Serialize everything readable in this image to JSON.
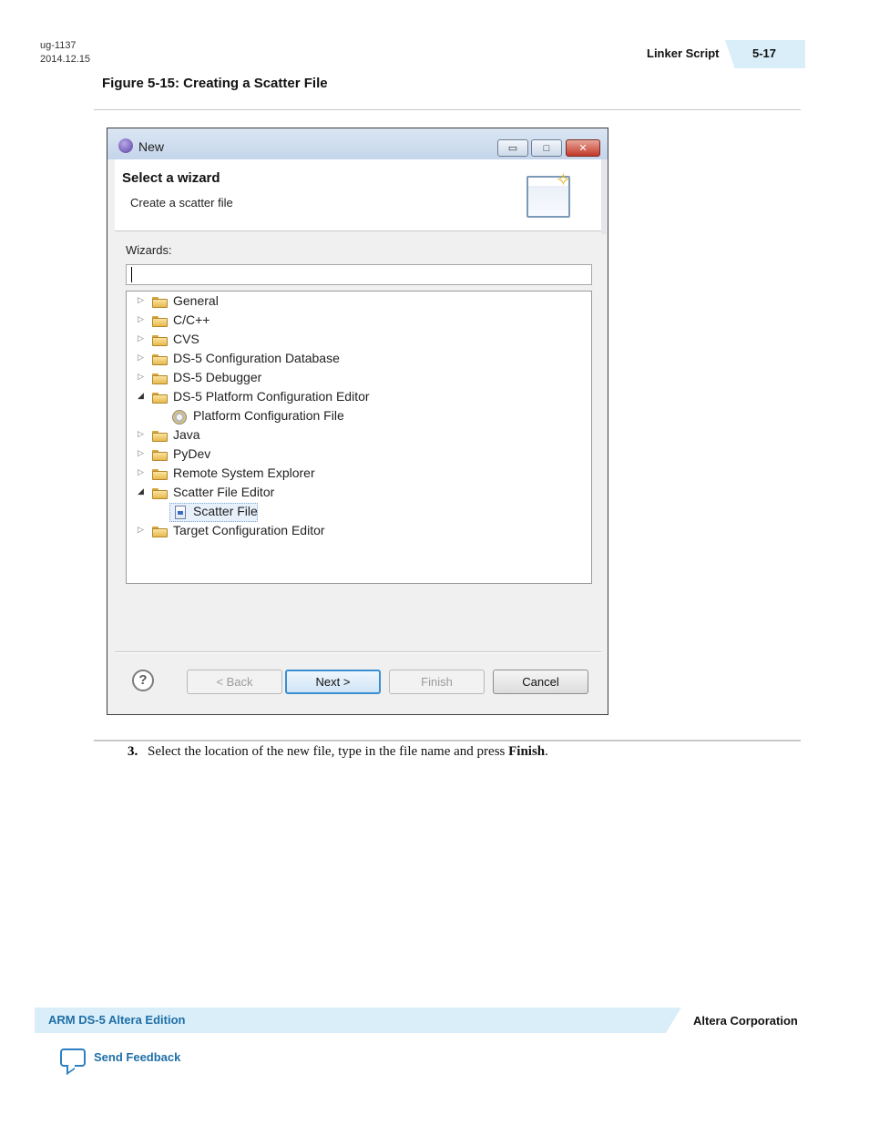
{
  "header": {
    "doc_id": "ug-1137",
    "date": "2014.12.15",
    "section": "Linker Script",
    "page": "5-17"
  },
  "figure": {
    "title": "Figure 5-15: Creating a Scatter File"
  },
  "dialog": {
    "title": "New",
    "window_buttons": {
      "minimize": "▭",
      "maximize": "□",
      "close": "✕"
    },
    "heading": "Select a wizard",
    "subheading": "Create a scatter file",
    "wizards_label": "Wizards:",
    "filter_value": "",
    "tree": [
      {
        "label": "General",
        "type": "folder",
        "level": 0,
        "expanded": false
      },
      {
        "label": "C/C++",
        "type": "folder",
        "level": 0,
        "expanded": false
      },
      {
        "label": "CVS",
        "type": "folder",
        "level": 0,
        "expanded": false
      },
      {
        "label": "DS-5 Configuration Database",
        "type": "folder",
        "level": 0,
        "expanded": false
      },
      {
        "label": "DS-5 Debugger",
        "type": "folder",
        "level": 0,
        "expanded": false
      },
      {
        "label": "DS-5 Platform Configuration Editor",
        "type": "folder",
        "level": 0,
        "expanded": true
      },
      {
        "label": "Platform Configuration File",
        "type": "gear",
        "level": 1
      },
      {
        "label": "Java",
        "type": "folder",
        "level": 0,
        "expanded": false
      },
      {
        "label": "PyDev",
        "type": "folder",
        "level": 0,
        "expanded": false
      },
      {
        "label": "Remote System Explorer",
        "type": "folder",
        "level": 0,
        "expanded": false
      },
      {
        "label": "Scatter File Editor",
        "type": "folder",
        "level": 0,
        "expanded": true
      },
      {
        "label": "Scatter File",
        "type": "file",
        "level": 1,
        "selected": true
      },
      {
        "label": "Target Configuration Editor",
        "type": "folder",
        "level": 0,
        "expanded": false
      }
    ],
    "buttons": {
      "back": "< Back",
      "next": "Next >",
      "finish": "Finish",
      "cancel": "Cancel"
    },
    "help_glyph": "?"
  },
  "step": {
    "number": "3.",
    "text": "Select the location of the new file, type in the file name and press ",
    "emphasis": "Finish",
    "end": "."
  },
  "footer": {
    "left": "ARM DS-5 Altera Edition",
    "right": "Altera Corporation",
    "feedback": "Send Feedback"
  },
  "colors": {
    "accent_band": "#d9eef8",
    "link_blue": "#1e6fa8",
    "default_button_border": "#3b8fd0"
  }
}
